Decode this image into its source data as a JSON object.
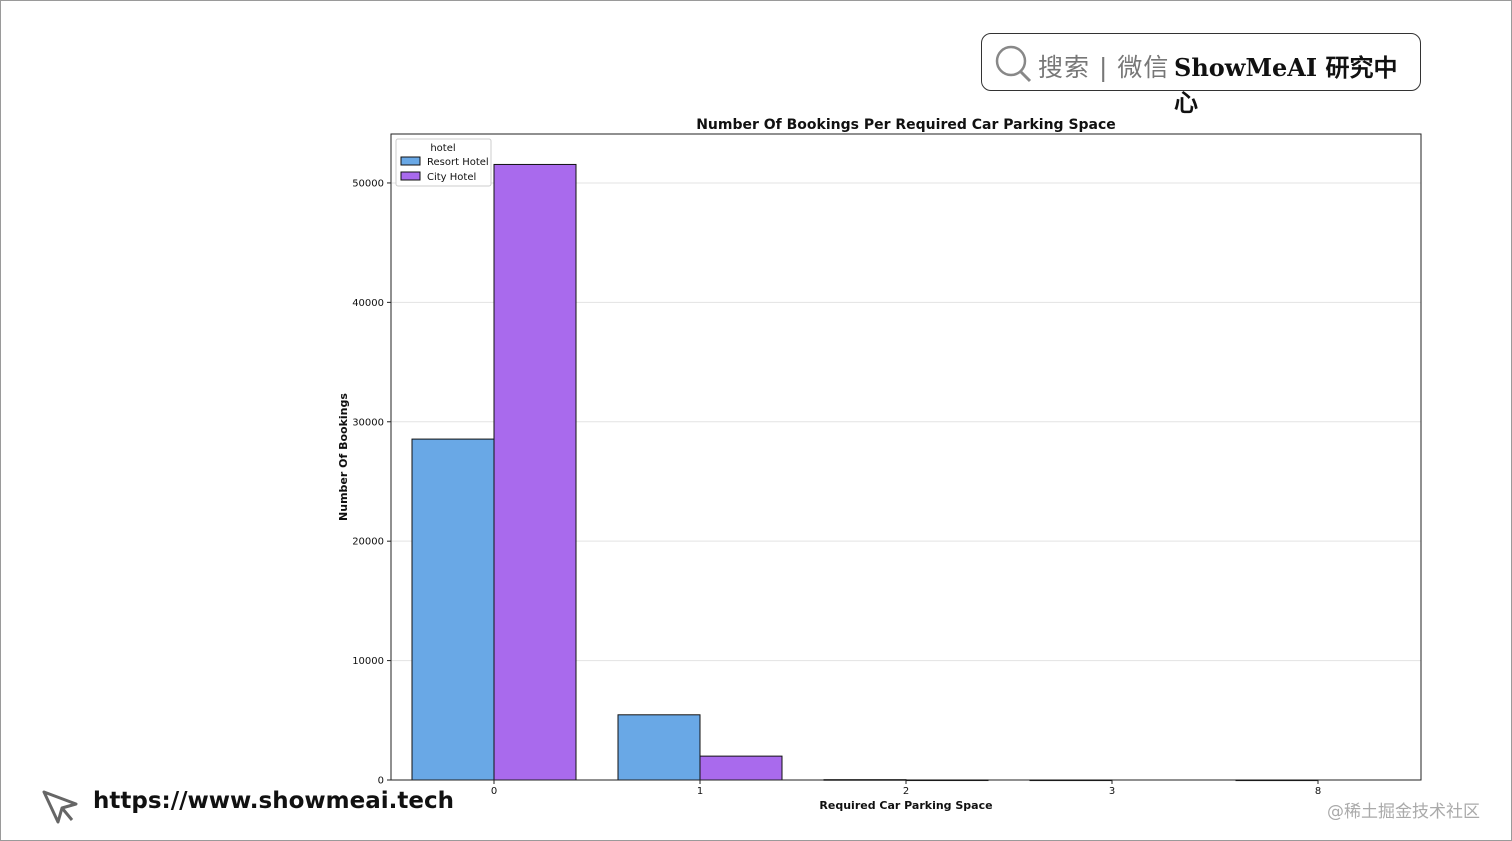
{
  "header": {
    "search_hint": "搜索 | 微信",
    "search_brand": "ShowMeAI 研究中心"
  },
  "footer": {
    "url": "https://www.showmeai.tech",
    "watermark": "@稀土掘金技术社区"
  },
  "chart_data": {
    "type": "bar",
    "title": "Number Of Bookings Per Required Car Parking Space",
    "xlabel": "Required Car Parking Space",
    "ylabel": "Number Of Bookings",
    "categories": [
      "0",
      "1",
      "2",
      "3",
      "8"
    ],
    "series": [
      {
        "name": "Resort Hotel",
        "color": "#69a8e6",
        "values": [
          28550,
          5460,
          30,
          3,
          2
        ]
      },
      {
        "name": "City Hotel",
        "color": "#a96aed",
        "values": [
          51550,
          2000,
          5,
          0,
          0
        ]
      }
    ],
    "ylim": [
      0,
      54100
    ],
    "yticks": [
      0,
      10000,
      20000,
      30000,
      40000,
      50000
    ],
    "legend": {
      "title": "hotel",
      "placement": "top-left"
    },
    "grid": "horizontal"
  }
}
